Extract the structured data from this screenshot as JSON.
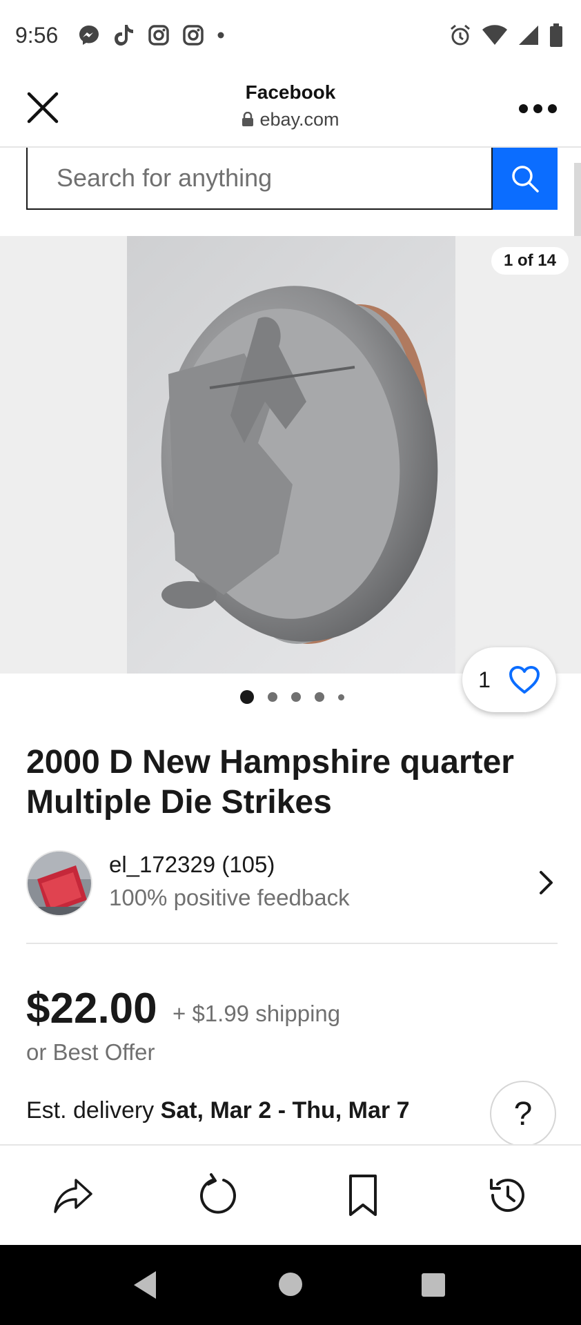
{
  "status_bar": {
    "time": "9:56",
    "left_icons": [
      "messenger-icon",
      "tiktok-icon",
      "instagram-icon",
      "instagram-icon",
      "dot-icon"
    ],
    "right_icons": [
      "alarm-icon",
      "wifi-icon",
      "signal-icon",
      "battery-icon"
    ]
  },
  "browser": {
    "title": "Facebook",
    "url": "ebay.com"
  },
  "search": {
    "placeholder": "Search for anything"
  },
  "gallery": {
    "counter": "1 of 14",
    "dots": 5,
    "active_dot": 0
  },
  "watch": {
    "count": "1"
  },
  "item": {
    "title": "2000 D New Hampshire quarter Multiple Die Strikes"
  },
  "seller": {
    "name": "el_172329 (105)",
    "feedback": "100% positive feedback"
  },
  "pricing": {
    "price": "$22.00",
    "shipping": "+ $1.99 shipping",
    "best_offer": "or Best Offer"
  },
  "delivery": {
    "label": "Est. delivery",
    "dates": "Sat, Mar 2 - Thu, Mar 7"
  },
  "help": {
    "label": "?"
  },
  "colors": {
    "accent": "#0b6dff",
    "text": "#191919",
    "muted": "#707070"
  }
}
